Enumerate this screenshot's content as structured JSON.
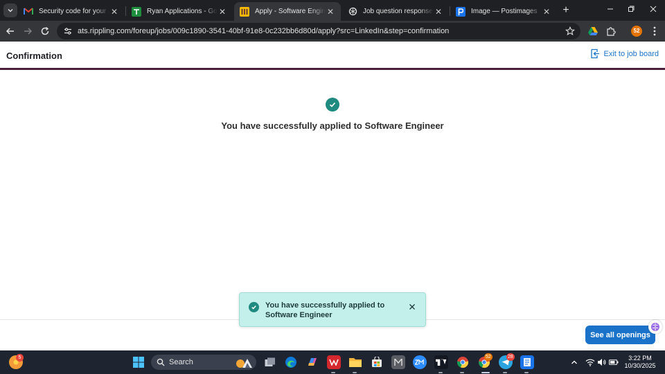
{
  "browser": {
    "tabs": [
      {
        "title": "Security code for your application",
        "favicon": "gmail-icon",
        "active": false
      },
      {
        "title": "Ryan Applications - Google Sheets",
        "favicon": "sheets-icon",
        "active": false
      },
      {
        "title": "Apply - Software Engineer",
        "favicon": "rippling-icon",
        "active": true
      },
      {
        "title": "Job question responses draft",
        "favicon": "chatgpt-icon",
        "active": false
      },
      {
        "title": "Image — Postimages",
        "favicon": "postimages-icon",
        "active": false
      }
    ],
    "url": "ats.rippling.com/foreup/jobs/009c1890-3541-40bf-91e8-0c232bb6d80d/apply?src=LinkedIn&step=confirmation",
    "profile_badge": "52"
  },
  "header": {
    "title": "Confirmation",
    "exit_label": "Exit to job board"
  },
  "main": {
    "success_message": "You have successfully applied to Software Engineer",
    "see_all_label": "See all openings"
  },
  "toast": {
    "message": "You have successfully applied to Software Engineer"
  },
  "taskbar": {
    "search_label": "Search",
    "widgets_badge": "5",
    "chrome_badge": "52",
    "telegram_badge": "28",
    "time": "3:22 PM",
    "date": "10/30/2025"
  },
  "colors": {
    "accent_blue": "#1a73c8",
    "success_teal": "#1f8a80",
    "toast_bg": "#c4f0ec",
    "header_rule": "#4a1f3c"
  }
}
